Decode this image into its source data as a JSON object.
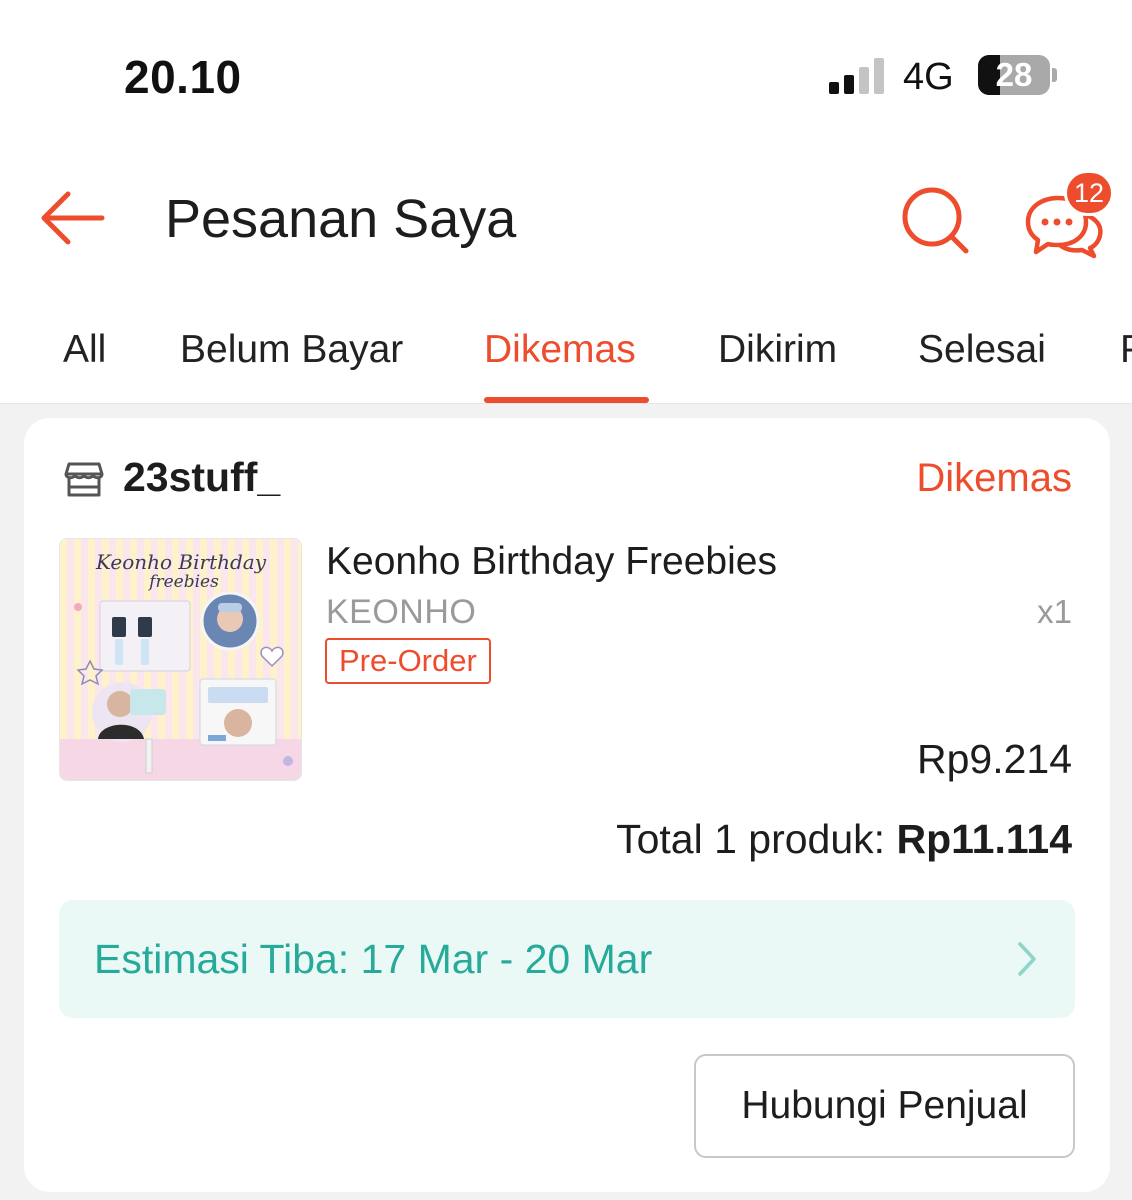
{
  "status_bar": {
    "time": "20.10",
    "network": "4G",
    "battery": "28",
    "signal_bars_active": 2,
    "signal_bars_total": 4
  },
  "header": {
    "title": "Pesanan Saya",
    "chat_badge": "12",
    "icons": [
      "back-arrow-icon",
      "search-icon",
      "chat-icon"
    ]
  },
  "tabs": [
    {
      "label": "All"
    },
    {
      "label": "Belum Bayar"
    },
    {
      "label": "Dikemas"
    },
    {
      "label": "Dikirim"
    },
    {
      "label": "Selesai"
    },
    {
      "label": "Pengembalian"
    }
  ],
  "order": {
    "store_name": "23stuff_",
    "status": "Dikemas",
    "product": {
      "name": "Keonho Birthday Freebies",
      "variation": "KEONHO",
      "quantity": "x1",
      "badge": "Pre-Order",
      "price": "Rp9.214",
      "thumbnail": {
        "title_line1": "Keonho Birthday",
        "title_line2": "freebies"
      }
    },
    "total_label": "Total 1 produk:",
    "total_amount": "Rp11.114",
    "eta": "Estimasi Tiba: 17 Mar - 20 Mar",
    "contact_button": "Hubungi Penjual"
  },
  "colors": {
    "accent": "#ee4d2d",
    "eta_text": "#26aa99",
    "eta_bg": "#eaf9f5",
    "page_bg": "#f2f2f2"
  }
}
